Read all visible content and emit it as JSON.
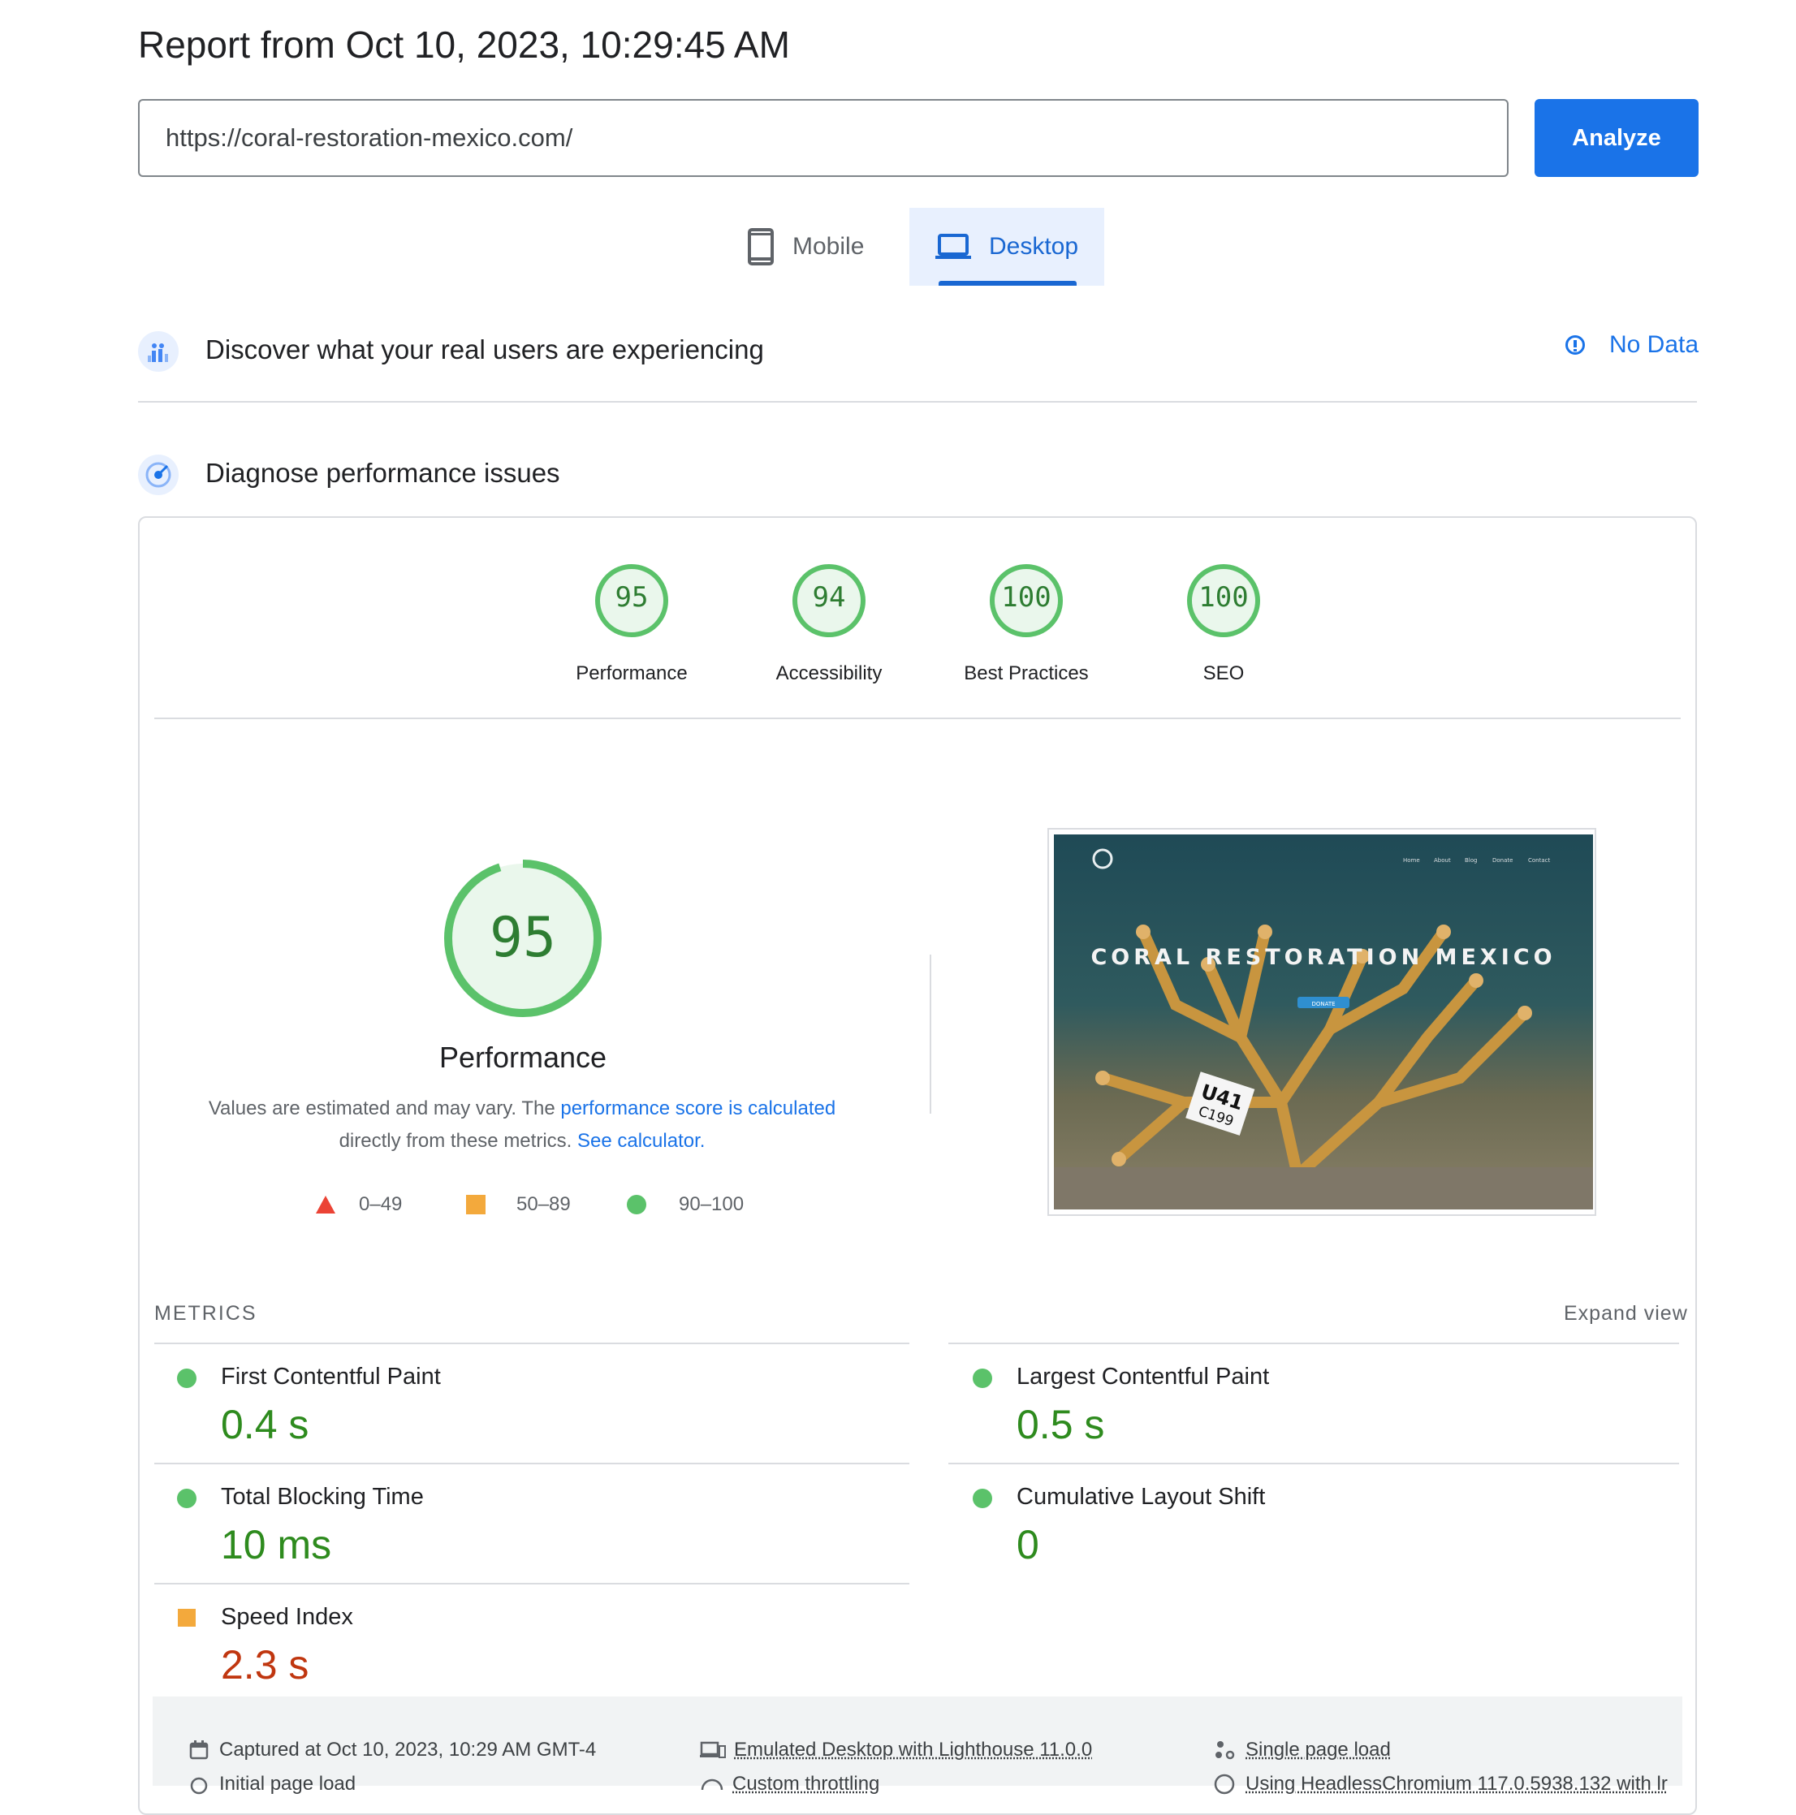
{
  "header": {
    "title": "Report from Oct 10, 2023, 10:29:45 AM",
    "url_value": "https://coral-restoration-mexico.com/",
    "analyze_label": "Analyze"
  },
  "tabs": [
    {
      "label": "Mobile",
      "active": false
    },
    {
      "label": "Desktop",
      "active": true
    }
  ],
  "field_section": {
    "title": "Discover what your real users are experiencing",
    "status": "No Data"
  },
  "lab_section": {
    "title": "Diagnose performance issues"
  },
  "scores": [
    {
      "label": "Performance",
      "value": 95
    },
    {
      "label": "Accessibility",
      "value": 94
    },
    {
      "label": "Best Practices",
      "value": 100
    },
    {
      "label": "SEO",
      "value": 100
    }
  ],
  "performance": {
    "score": 95,
    "label": "Performance",
    "desc_prefix": "Values are estimated and may vary. The ",
    "desc_link1": "performance score is calculated",
    "desc_middle": "directly from these metrics. ",
    "desc_link2": "See calculator."
  },
  "legend": [
    {
      "range": "0–49",
      "shape": "triangle",
      "color": "#eb4335"
    },
    {
      "range": "50–89",
      "shape": "square",
      "color": "#f3a93c"
    },
    {
      "range": "90–100",
      "shape": "circle",
      "color": "#5bc26a"
    }
  ],
  "screenshot": {
    "site_title": "CORAL RESTORATION MEXICO",
    "nav": [
      "Home",
      "About",
      "Blog",
      "Donate",
      "Contact"
    ],
    "button": "DONATE",
    "tag_line1": "U41",
    "tag_line2": "C199"
  },
  "metrics": {
    "title": "METRICS",
    "expand_label": "Expand view",
    "items": [
      {
        "name": "First Contentful Paint",
        "value": "0.4 s",
        "rating": "good"
      },
      {
        "name": "Largest Contentful Paint",
        "value": "0.5 s",
        "rating": "good"
      },
      {
        "name": "Total Blocking Time",
        "value": "10 ms",
        "rating": "good"
      },
      {
        "name": "Cumulative Layout Shift",
        "value": "0",
        "rating": "good"
      },
      {
        "name": "Speed Index",
        "value": "2.3 s",
        "rating": "average"
      }
    ]
  },
  "footer": {
    "captured": "Captured at Oct 10, 2023, 10:29 AM GMT-4",
    "emulated": "Emulated Desktop with Lighthouse 11.0.0",
    "single": "Single page load",
    "initial": "Initial page load",
    "throttling": "Custom throttling",
    "browser": "Using HeadlessChromium 117.0.5938.132 with lr"
  },
  "colors": {
    "accent": "#1a73e8",
    "good": "#0cce6b",
    "average": "#ffa400",
    "poor": "#ff4e42"
  }
}
